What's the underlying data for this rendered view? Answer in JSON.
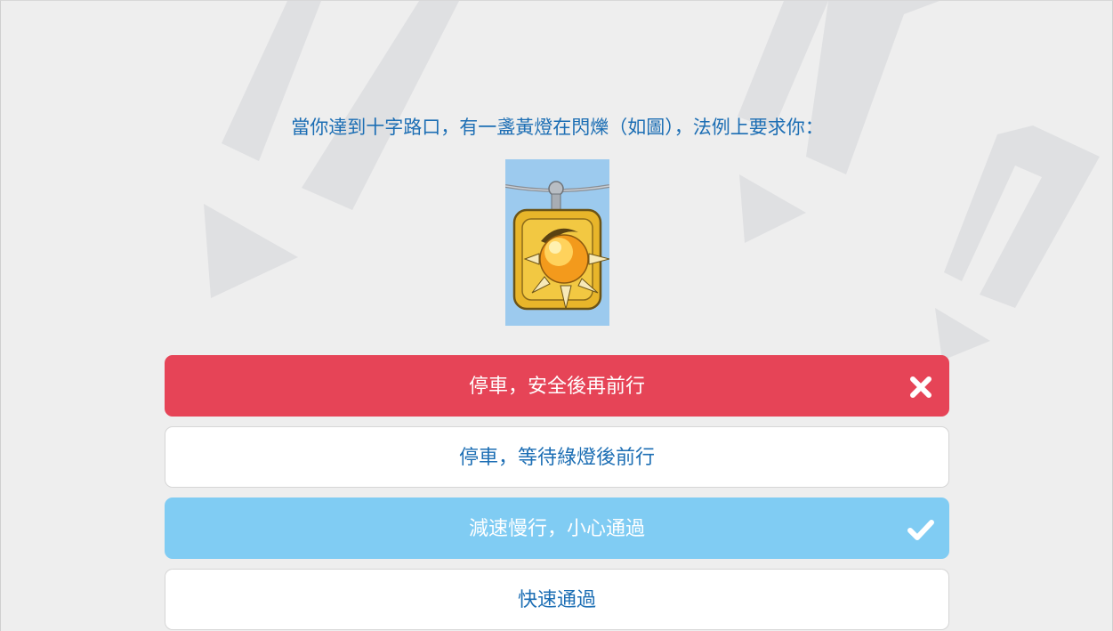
{
  "quiz": {
    "question": "當你達到十字路口，有一盞黃燈在閃爍（如圖），法例上要求你：",
    "image_alt": "flashing-amber-traffic-light",
    "options": [
      {
        "label": "停車，安全後再前行",
        "state": "wrong",
        "icon": "cross-icon"
      },
      {
        "label": "停車，等待綠燈後前行",
        "state": "neutral",
        "icon": ""
      },
      {
        "label": "減速慢行，小心通過",
        "state": "correct",
        "icon": "check-icon"
      },
      {
        "label": "快速通過",
        "state": "neutral",
        "icon": ""
      }
    ]
  },
  "colors": {
    "background": "#eeeeee",
    "question_text": "#1c6eb4",
    "wrong": "#e64457",
    "correct": "#80ccf3",
    "neutral_bg": "#ffffff",
    "deco": "#dfe0e2"
  }
}
